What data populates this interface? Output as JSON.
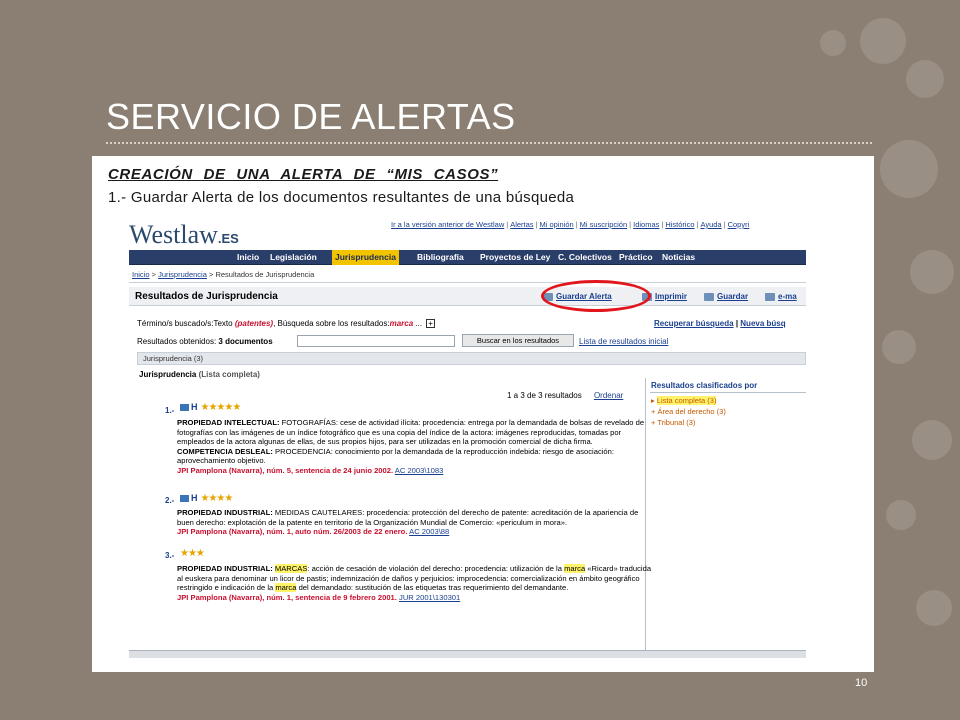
{
  "slide": {
    "title": "SERVICIO DE ALERTAS",
    "subtitle": "CREACIÓN  DE  UNA  ALERTA  DE  “MIS CASOS”",
    "step": "1.- Guardar Alerta de los documentos resultantes de una búsqueda",
    "page_number": "10",
    "colors": {
      "background": "#8a7f72",
      "highlight_circle": "#e1151c"
    }
  },
  "browser": {
    "logo": {
      "text": "Westlaw",
      "suffix": ".ES"
    },
    "top_links": [
      "Ir a la versión anterior de Westlaw",
      "Alertas",
      "Mi opinión",
      "Mi suscripción",
      "Idiomas",
      "Histórico",
      "Ayuda",
      "Copyri"
    ],
    "menu": [
      "Inicio",
      "Legislación",
      "Jurisprudencia",
      "Bibliografía",
      "Proyectos de Ley",
      "C. Colectivos",
      "Práctico",
      "Noticias"
    ],
    "active_menu": "Jurisprudencia",
    "breadcrumb": {
      "home": "Inicio",
      "section": "Jurisprudencia",
      "current": "Resultados de Jurisprudencia",
      "sep": ">"
    },
    "results_title": "Resultados de Jurisprudencia",
    "tools": [
      "Guardar Alerta",
      "Imprimir",
      "Guardar",
      "e-ma"
    ],
    "search": {
      "label": "Término/s buscado/s:Texto",
      "term": "(patentes)",
      "within_label": ", Búsqueda sobre los resultados:",
      "within_term": "marca",
      "ellipsis": "...",
      "expand": "+"
    },
    "right_links": [
      "Recuperar búsqueda",
      "Nueva búsq"
    ],
    "obtained": {
      "label": "Resultados obtenidos:",
      "value": "3 documentos"
    },
    "search_button": "Buscar en los resultados",
    "initial_list_link": "Lista de resultados inicial",
    "section_tab": "Jurisprudencia (3)",
    "list_heading": {
      "bold": "Jurisprudencia",
      "rest": "(Lista completa)"
    },
    "count": "1 a 3 de 3 resultados",
    "order_link": "Ordenar",
    "sidebar": {
      "title": "Resultados clasificados por",
      "items": [
        "Lista completa (3)",
        "Área del derecho (3)",
        "Tribunal (3)"
      ]
    },
    "documents": [
      {
        "num": "1.-",
        "stars": "★★★★★",
        "badge": "H",
        "head1": "PROPIEDAD INTELECTUAL:",
        "text1": " FOTOGRAFÍAS: cese de actividad ilícita: procedencia: entrega por la demandada de bolsas de revelado de fotografías con las imágenes de un índice fotográfico que es una copia del índice de la actora: imágenes reproducidas, tomadas por empleados de la actora algunas de ellas, de sus propios hijos, para ser utilizadas en la promoción comercial de dicha firma.",
        "head2": "COMPETENCIA DESLEAL:",
        "text2": " PROCEDENCIA: conocimiento por la demandada de la reproducción indebida: riesgo de asociación: aprovechamiento objetivo.",
        "citation": "JPI Pamplona (Navarra), núm. 5, sentencia de 24 junio 2002.",
        "ref": "AC 2003\\1083"
      },
      {
        "num": "2.-",
        "stars": "★★★★",
        "badge": "H",
        "head1": "PROPIEDAD INDUSTRIAL:",
        "text1": " MEDIDAS CAUTELARES: procedencia: protección del derecho de patente: acreditación de la apariencia de buen derecho: explotación de la patente en territorio de la Organización Mundial de Comercio: «periculum in mora».",
        "citation": "JPI Pamplona (Navarra), núm. 1, auto núm. 26/2003 de 22 enero.",
        "ref": "AC 2003\\88"
      },
      {
        "num": "3.-",
        "stars": "★★★",
        "head1": "PROPIEDAD INDUSTRIAL:",
        "hl1": "MARCAS",
        "text1a": ": acción de cesación de violación del derecho: procedencia: utilización de la ",
        "hl2": "marca",
        "text1b": " «Ricard» traducida al euskera para denominar un licor de pastis; indemnización de daños y perjuicios: improcedencia: comercialización en ámbito geográfico restringido e indicación de la ",
        "hl3": "marca",
        "text1c": " del demandado: sustitución de las etiquetas tras requerimiento del demandante.",
        "citation": "JPI Pamplona (Navarra), núm. 1, sentencia de 9 febrero 2001.",
        "ref": "JUR 2001\\130301"
      }
    ]
  }
}
